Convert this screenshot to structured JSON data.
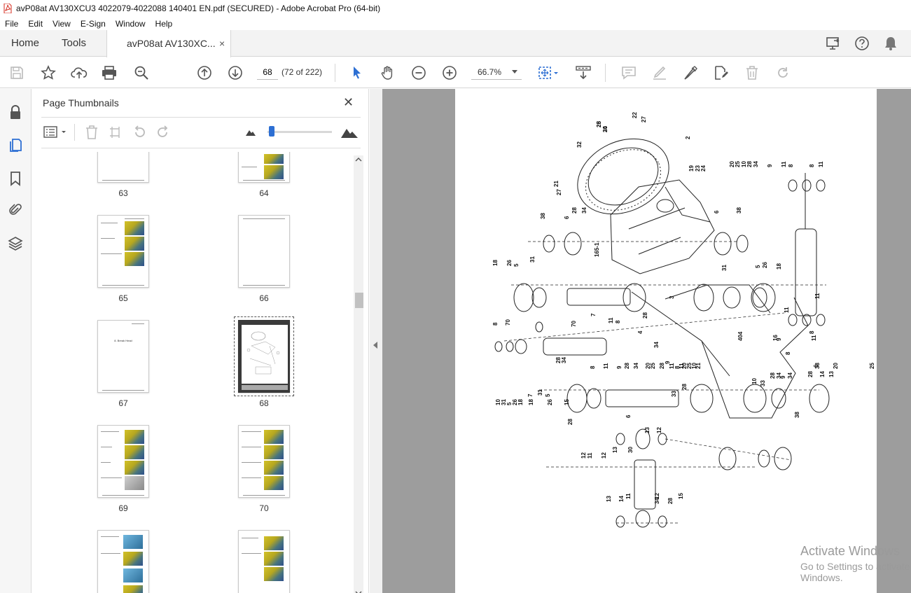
{
  "window": {
    "title": "avP08at AV130XCU3 4022079-4022088 140401 EN.pdf (SECURED) - Adobe Acrobat Pro (64-bit)"
  },
  "menu": [
    "File",
    "Edit",
    "View",
    "E-Sign",
    "Window",
    "Help"
  ],
  "tabs": {
    "home": "Home",
    "tools": "Tools",
    "document": "avP08at AV130XC...",
    "close": "×"
  },
  "toolbar": {
    "page_number": "68",
    "page_count": "(72 of 222)",
    "zoom": "66.7%"
  },
  "panel": {
    "title": "Page Thumbnails",
    "close": "✕"
  },
  "thumbnails": [
    {
      "label": "63"
    },
    {
      "label": "64"
    },
    {
      "label": "65"
    },
    {
      "label": "66"
    },
    {
      "label": "67",
      "heading": "8. Break Head"
    },
    {
      "label": "68"
    },
    {
      "label": "69"
    },
    {
      "label": "70"
    },
    {
      "label": ""
    },
    {
      "label": ""
    }
  ],
  "diagram": {
    "part_numbers": [
      "28",
      "34",
      "22",
      "27",
      "32",
      "2",
      "21",
      "27",
      "28",
      "34",
      "19",
      "23",
      "24",
      "20",
      "25",
      "10",
      "28",
      "34",
      "9",
      "11",
      "8",
      "8",
      "11",
      "38",
      "6",
      "6",
      "38",
      "165-1",
      "18",
      "26",
      "31",
      "5",
      "7",
      "3",
      "31",
      "5",
      "26",
      "18",
      "70",
      "8",
      "9",
      "11",
      "11",
      "8",
      "28",
      "34",
      "4",
      "8",
      "11",
      "11",
      "8",
      "70",
      "28",
      "34",
      "404",
      "16",
      "8",
      "9",
      "11",
      "28",
      "34",
      "9",
      "11",
      "8",
      "11",
      "20",
      "25",
      "10",
      "21",
      "28",
      "20",
      "25",
      "10",
      "31",
      "5",
      "26",
      "18",
      "18",
      "26",
      "5",
      "31",
      "7",
      "15",
      "28",
      "6",
      "33",
      "28",
      "33",
      "38",
      "6",
      "38",
      "20",
      "25",
      "10",
      "28",
      "34",
      "9",
      "34",
      "28",
      "14",
      "13",
      "12",
      "11",
      "12",
      "13",
      "30",
      "13",
      "12",
      "11",
      "12",
      "13",
      "14",
      "34",
      "28",
      "15",
      "25",
      "20"
    ]
  },
  "watermark": {
    "line1": "Activate Windows",
    "line2": "Go to Settings to activate Windows."
  },
  "colors": {
    "accent": "#2d6fd3",
    "doc_background": "#9d9d9d",
    "pdf_red": "#d52b1e"
  }
}
